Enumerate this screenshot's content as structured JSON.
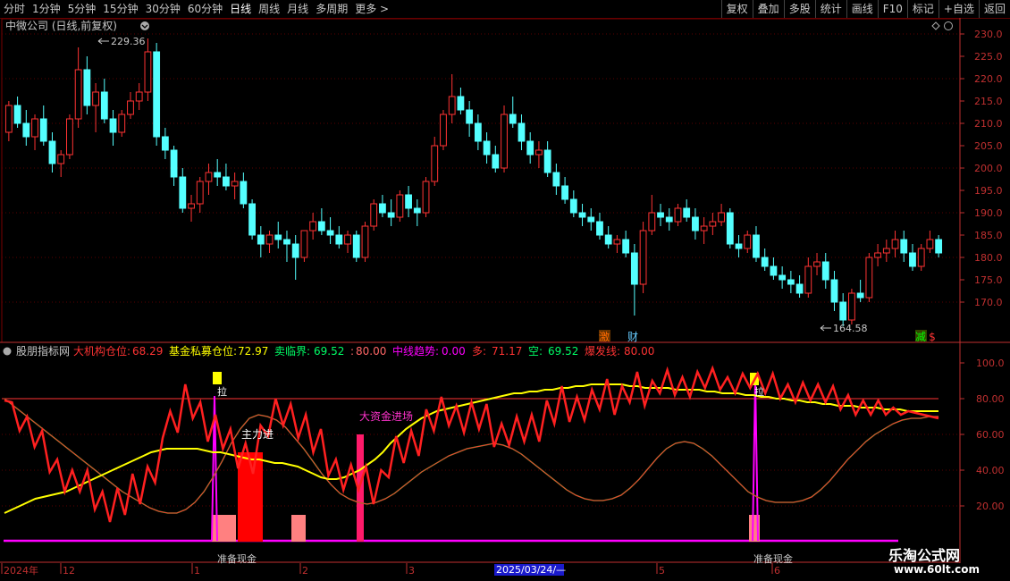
{
  "toolbar": {
    "left": [
      "分时",
      "1分钟",
      "5分钟",
      "15分钟",
      "30分钟",
      "60分钟",
      "日线",
      "周线",
      "月线",
      "多周期",
      "更多 >"
    ],
    "active_index": 6,
    "right": [
      "复权",
      "叠加",
      "多股",
      "统计",
      "画线",
      "F10",
      "标记",
      "+自选",
      "返回"
    ]
  },
  "stock_title": "中微公司 (日线,前复权)",
  "high_label": "229.36",
  "low_label": "164.58",
  "price_axis": [
    "230.0",
    "225.0",
    "220.0",
    "215.0",
    "210.0",
    "205.0",
    "200.0",
    "195.0",
    "190.0",
    "185.0",
    "180.0",
    "175.0",
    "170.0"
  ],
  "event_marks": [
    {
      "text": "激",
      "color": "#ff6a00"
    },
    {
      "text": "财",
      "color": "#66ccff"
    },
    {
      "text": "减",
      "color": "#00ff00"
    },
    {
      "text": "$",
      "color": "#ff3333"
    }
  ],
  "indicator": {
    "name": "股朋指标网",
    "items": [
      {
        "label": "大机构仓位:",
        "value": "68.29",
        "color": "#ff3333"
      },
      {
        "label": "基金私募仓位:",
        "value": "72.97",
        "color": "#ffff00"
      },
      {
        "label": "卖临界:",
        "value": "69.52",
        "color": "#00ff66"
      },
      {
        "label": ":",
        "value": "80.00",
        "color": "#ff6666"
      },
      {
        "label": "中线趋势:",
        "value": "0.00",
        "color": "#ff00ff"
      },
      {
        "label": "多:",
        "value": "71.17",
        "color": "#ff3333"
      },
      {
        "label": "空:",
        "value": "69.52",
        "color": "#00ff66"
      },
      {
        "label": "爆发线:",
        "value": "80.00",
        "color": "#ff3333"
      }
    ],
    "axis": [
      "100.0",
      "80.00",
      "60.00",
      "40.00",
      "20.00"
    ],
    "annotations": {
      "main_in": "主力进",
      "big_money": "大资金进场",
      "ready_cash": "准备现金",
      "ready_cash2": "准备现金",
      "la": "拉",
      "la2": "拉"
    }
  },
  "date_axis": {
    "labels": [
      "2024年",
      "12",
      "1",
      "2",
      "3",
      "5",
      "6"
    ],
    "highlight": "2025/03/24/—"
  },
  "watermark": {
    "title": "乐淘公式网",
    "url": "www.60lt.com"
  },
  "colors": {
    "up": "#ff3333",
    "down": "#54ffff",
    "grid": "#7a0000",
    "axis": "#c03030"
  },
  "price_range": [
    164.58,
    229.36
  ],
  "candles_ohlc": [
    [
      208,
      215,
      206,
      214
    ],
    [
      214,
      216,
      209,
      210
    ],
    [
      210,
      213,
      205,
      207
    ],
    [
      207,
      212,
      204,
      211
    ],
    [
      211,
      214,
      205,
      206
    ],
    [
      206,
      208,
      199,
      201
    ],
    [
      201,
      204,
      198,
      203
    ],
    [
      203,
      212,
      202,
      211
    ],
    [
      211,
      227,
      209,
      222
    ],
    [
      222,
      225,
      212,
      214
    ],
    [
      214,
      219,
      208,
      217
    ],
    [
      217,
      220,
      210,
      211
    ],
    [
      211,
      213,
      205,
      208
    ],
    [
      208,
      213,
      207,
      212
    ],
    [
      212,
      217,
      211,
      215
    ],
    [
      215,
      219,
      213,
      217
    ],
    [
      217,
      229,
      215,
      226
    ],
    [
      226,
      228,
      205,
      207
    ],
    [
      207,
      209,
      202,
      204
    ],
    [
      204,
      205,
      196,
      198
    ],
    [
      198,
      200,
      190,
      191
    ],
    [
      191,
      194,
      188,
      192
    ],
    [
      192,
      198,
      190,
      197
    ],
    [
      197,
      201,
      194,
      199
    ],
    [
      199,
      202,
      196,
      198
    ],
    [
      198,
      201,
      195,
      196
    ],
    [
      196,
      199,
      193,
      197
    ],
    [
      197,
      199,
      191,
      192
    ],
    [
      192,
      193,
      184,
      185
    ],
    [
      185,
      187,
      180,
      183
    ],
    [
      183,
      186,
      181,
      185
    ],
    [
      185,
      188,
      182,
      184
    ],
    [
      184,
      186,
      179,
      183
    ],
    [
      183,
      185,
      175,
      180
    ],
    [
      180,
      186,
      179,
      186
    ],
    [
      186,
      190,
      184,
      188
    ],
    [
      188,
      191,
      185,
      186
    ],
    [
      186,
      189,
      183,
      185
    ],
    [
      185,
      187,
      182,
      183
    ],
    [
      183,
      186,
      181,
      185
    ],
    [
      185,
      186,
      179,
      180
    ],
    [
      180,
      188,
      179,
      187
    ],
    [
      187,
      193,
      186,
      192
    ],
    [
      192,
      194,
      189,
      190
    ],
    [
      190,
      193,
      187,
      189
    ],
    [
      189,
      195,
      188,
      194
    ],
    [
      194,
      196,
      189,
      191
    ],
    [
      191,
      193,
      187,
      190
    ],
    [
      190,
      198,
      189,
      197
    ],
    [
      197,
      207,
      196,
      205
    ],
    [
      205,
      213,
      204,
      212
    ],
    [
      212,
      221,
      210,
      216
    ],
    [
      216,
      218,
      212,
      213
    ],
    [
      213,
      215,
      207,
      210
    ],
    [
      210,
      212,
      204,
      206
    ],
    [
      206,
      208,
      201,
      203
    ],
    [
      203,
      205,
      199,
      200
    ],
    [
      200,
      214,
      199,
      212
    ],
    [
      212,
      216,
      209,
      210
    ],
    [
      210,
      212,
      204,
      206
    ],
    [
      206,
      208,
      201,
      203
    ],
    [
      203,
      206,
      200,
      204
    ],
    [
      204,
      206,
      198,
      199
    ],
    [
      199,
      201,
      194,
      196
    ],
    [
      196,
      198,
      192,
      193
    ],
    [
      193,
      195,
      189,
      190
    ],
    [
      190,
      192,
      187,
      189
    ],
    [
      189,
      191,
      186,
      188
    ],
    [
      188,
      190,
      184,
      185
    ],
    [
      185,
      187,
      182,
      183
    ],
    [
      183,
      185,
      181,
      184
    ],
    [
      184,
      186,
      180,
      181
    ],
    [
      181,
      183,
      167,
      174
    ],
    [
      174,
      188,
      172,
      186
    ],
    [
      186,
      194,
      185,
      190
    ],
    [
      190,
      192,
      187,
      189
    ],
    [
      189,
      191,
      186,
      188
    ],
    [
      188,
      192,
      187,
      191
    ],
    [
      191,
      193,
      188,
      189
    ],
    [
      189,
      191,
      184,
      186
    ],
    [
      186,
      189,
      183,
      187
    ],
    [
      187,
      190,
      185,
      188
    ],
    [
      188,
      192,
      187,
      190
    ],
    [
      190,
      191,
      182,
      183
    ],
    [
      183,
      185,
      180,
      182
    ],
    [
      182,
      186,
      181,
      185
    ],
    [
      185,
      187,
      179,
      180
    ],
    [
      180,
      182,
      177,
      178
    ],
    [
      178,
      180,
      175,
      176
    ],
    [
      176,
      178,
      173,
      175
    ],
    [
      175,
      177,
      172,
      174
    ],
    [
      174,
      176,
      171,
      172
    ],
    [
      172,
      180,
      171,
      178
    ],
    [
      178,
      181,
      176,
      179
    ],
    [
      179,
      181,
      173,
      175
    ],
    [
      175,
      177,
      168,
      170
    ],
    [
      170,
      172,
      164.6,
      166
    ],
    [
      166,
      173,
      165,
      172
    ],
    [
      172,
      175,
      170,
      171
    ],
    [
      171,
      181,
      170,
      180
    ],
    [
      180,
      183,
      178,
      181
    ],
    [
      181,
      184,
      179,
      182
    ],
    [
      182,
      186,
      180,
      184
    ],
    [
      184,
      186,
      179,
      181
    ],
    [
      181,
      183,
      177,
      178
    ],
    [
      178,
      183,
      177,
      182
    ],
    [
      182,
      186,
      181,
      184
    ],
    [
      184,
      185,
      180,
      181
    ]
  ],
  "series": {
    "dajigou": [
      79,
      73,
      68,
      62,
      57,
      52,
      47,
      42,
      38,
      34,
      31,
      28,
      25,
      23,
      22,
      21,
      20,
      24,
      29,
      36,
      45,
      55,
      63,
      70,
      73,
      75,
      74,
      70,
      64,
      57,
      52,
      50,
      49,
      51,
      57,
      63,
      68,
      72,
      72,
      68,
      62,
      56,
      50,
      45,
      42,
      40,
      36,
      34,
      32,
      30,
      34,
      40,
      47,
      52,
      57,
      61,
      65,
      68,
      70,
      72,
      72,
      71,
      70,
      68,
      65,
      62,
      60,
      58,
      60,
      63,
      66,
      67,
      70,
      72,
      74,
      75,
      77,
      78,
      78,
      79,
      80,
      80,
      81,
      82,
      83,
      84,
      85,
      86,
      87,
      88,
      88,
      89,
      89,
      90,
      90,
      90,
      89,
      89,
      89,
      89,
      88,
      87,
      86,
      85,
      85,
      85,
      84,
      83,
      82,
      81,
      80,
      79,
      78,
      77,
      76,
      75,
      74,
      74,
      73,
      73,
      72,
      72,
      71,
      70,
      69
    ],
    "jijin": [
      16,
      18,
      20,
      22,
      24,
      25,
      26,
      27,
      28,
      30,
      32,
      34,
      36,
      38,
      40,
      42,
      44,
      46,
      48,
      50,
      51,
      52,
      52,
      52,
      52,
      52,
      51,
      50,
      50,
      49,
      48,
      47,
      46,
      46,
      45,
      44,
      44,
      43,
      42,
      40,
      38,
      36,
      35,
      35,
      36,
      38,
      40,
      43,
      46,
      50,
      55,
      59,
      63,
      66,
      69,
      71,
      73,
      74,
      75,
      76,
      77,
      78,
      79,
      80,
      81,
      82,
      83,
      83,
      84,
      84,
      85,
      85,
      86,
      86,
      87,
      87,
      88,
      88,
      88,
      88,
      88,
      87,
      87,
      86,
      86,
      86,
      86,
      85,
      85,
      85,
      85,
      84,
      84,
      83,
      83,
      83,
      82,
      82,
      81,
      81,
      80,
      80,
      79,
      79,
      78,
      78,
      77,
      77,
      76,
      76,
      76,
      75,
      75,
      75,
      74,
      74,
      74,
      73,
      73,
      73,
      73,
      73
    ],
    "mai": [
      80,
      76,
      72,
      68,
      64,
      60,
      56,
      52,
      48,
      44,
      40,
      36,
      32,
      28,
      25,
      22,
      19,
      17,
      16,
      16,
      18,
      22,
      28,
      36,
      45,
      55,
      63,
      69,
      71,
      70,
      68,
      64,
      58,
      52,
      45,
      38,
      32,
      27,
      24,
      22,
      21,
      22,
      24,
      27,
      31,
      35,
      39,
      42,
      45,
      48,
      50,
      52,
      53,
      54,
      55,
      54,
      52,
      49,
      45,
      41,
      37,
      33,
      29,
      26,
      24,
      23,
      23,
      24,
      26,
      30,
      35,
      41,
      47,
      52,
      55,
      56,
      55,
      52,
      48,
      43,
      38,
      33,
      28,
      25,
      23,
      22,
      22,
      22,
      23,
      25,
      29,
      34,
      40,
      46,
      51,
      56,
      60,
      63,
      66,
      68,
      69,
      69,
      70,
      70
    ]
  }
}
